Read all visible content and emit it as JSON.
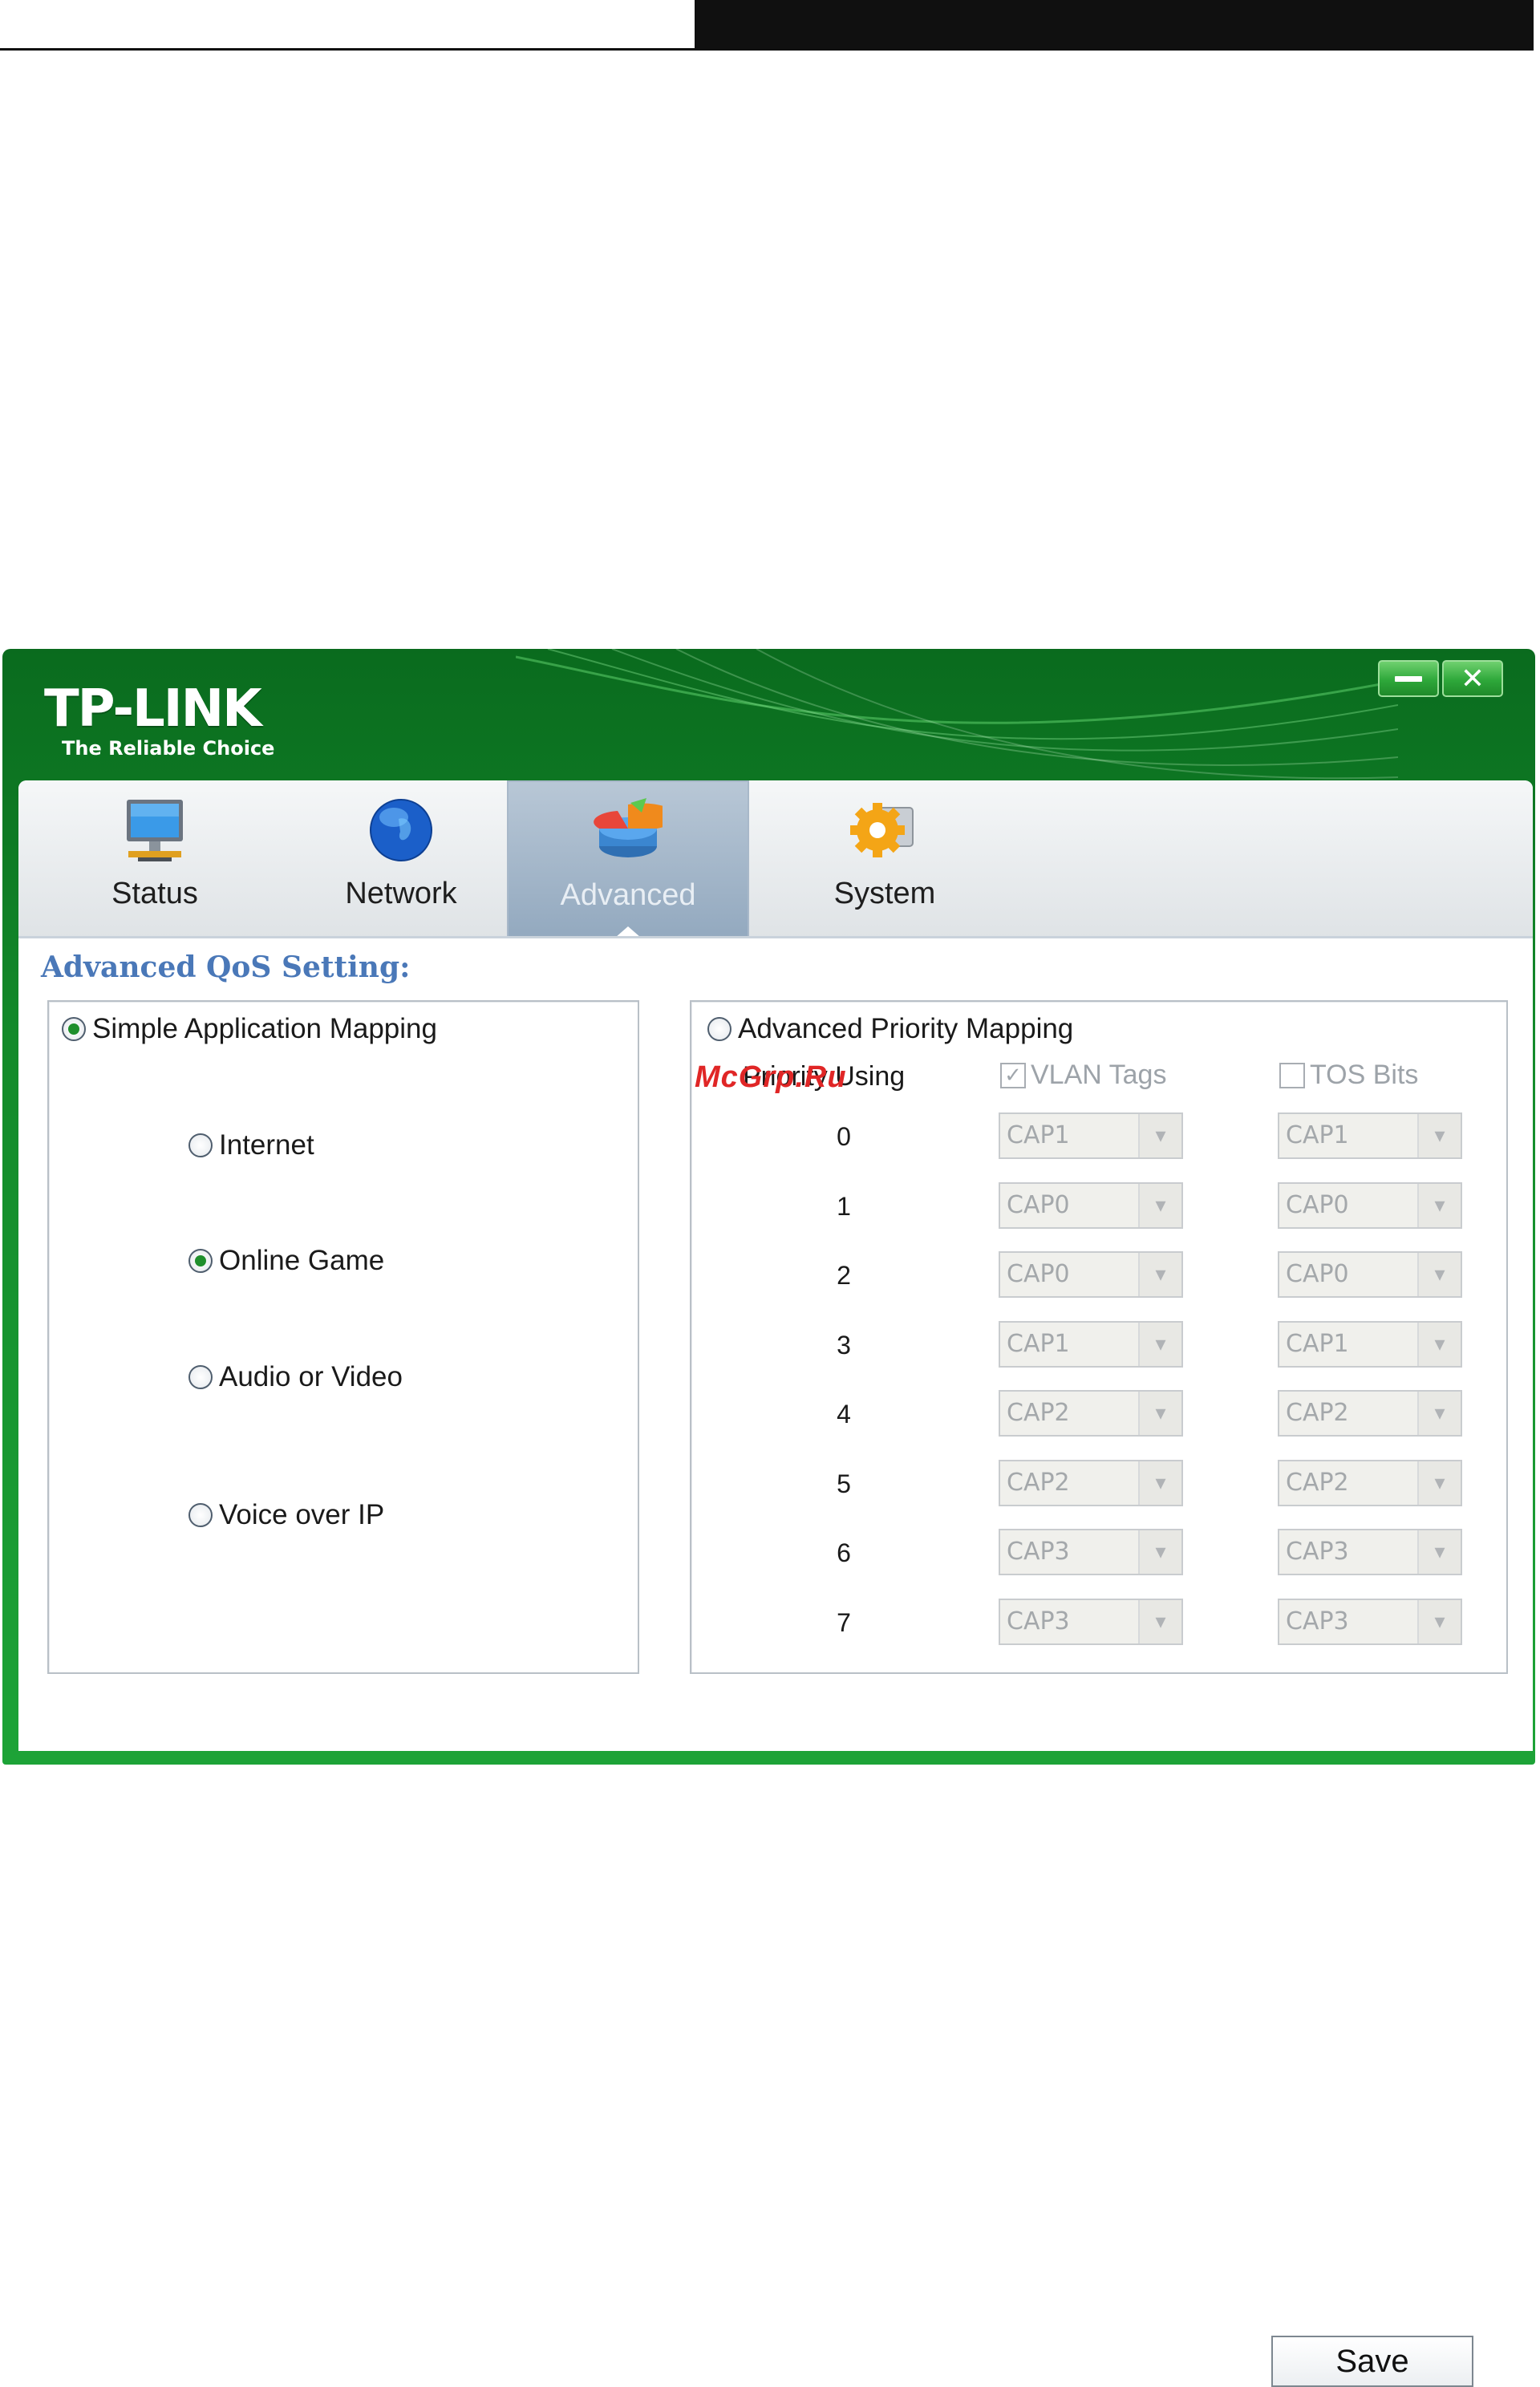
{
  "app": {
    "brand": "TP-LINK",
    "tagline": "The Reliable Choice"
  },
  "window_controls": {
    "minimize_icon": "minimize-icon",
    "close_icon": "close-icon",
    "close_glyph": "✕"
  },
  "tabs": [
    {
      "label": "Status",
      "icon": "monitor-icon",
      "active": false
    },
    {
      "label": "Network",
      "icon": "globe-icon",
      "active": false
    },
    {
      "label": "Advanced",
      "icon": "pie-chart-icon",
      "active": true
    },
    {
      "label": "System",
      "icon": "gear-icon",
      "active": false
    }
  ],
  "section": {
    "title": "Advanced QoS Setting:"
  },
  "simple_mapping": {
    "label": "Simple Application Mapping",
    "selected": true,
    "options": [
      {
        "label": "Internet",
        "selected": false
      },
      {
        "label": "Online Game",
        "selected": true
      },
      {
        "label": "Audio or Video",
        "selected": false
      },
      {
        "label": "Voice over IP",
        "selected": false
      }
    ]
  },
  "advanced_mapping": {
    "label": "Advanced Priority Mapping",
    "selected": false,
    "priority_using": "Priority Using",
    "vlan_tags": {
      "label": "VLAN Tags",
      "checked": true,
      "check_glyph": "✓"
    },
    "tos_bits": {
      "label": "TOS Bits",
      "checked": false
    },
    "rows": [
      {
        "priority": "0",
        "vlan": "CAP1",
        "tos": "CAP1"
      },
      {
        "priority": "1",
        "vlan": "CAP0",
        "tos": "CAP0"
      },
      {
        "priority": "2",
        "vlan": "CAP0",
        "tos": "CAP0"
      },
      {
        "priority": "3",
        "vlan": "CAP1",
        "tos": "CAP1"
      },
      {
        "priority": "4",
        "vlan": "CAP2",
        "tos": "CAP2"
      },
      {
        "priority": "5",
        "vlan": "CAP2",
        "tos": "CAP2"
      },
      {
        "priority": "6",
        "vlan": "CAP3",
        "tos": "CAP3"
      },
      {
        "priority": "7",
        "vlan": "CAP3",
        "tos": "CAP3"
      }
    ],
    "dropdown_glyph": "▾"
  },
  "actions": {
    "save_label": "Save"
  },
  "watermark": "McGrp.Ru",
  "colors": {
    "brand_green": "#1da337",
    "section_title": "#4a78b8",
    "radio_selected": "#1f8f2c",
    "disabled_text": "#a4a8ab"
  }
}
